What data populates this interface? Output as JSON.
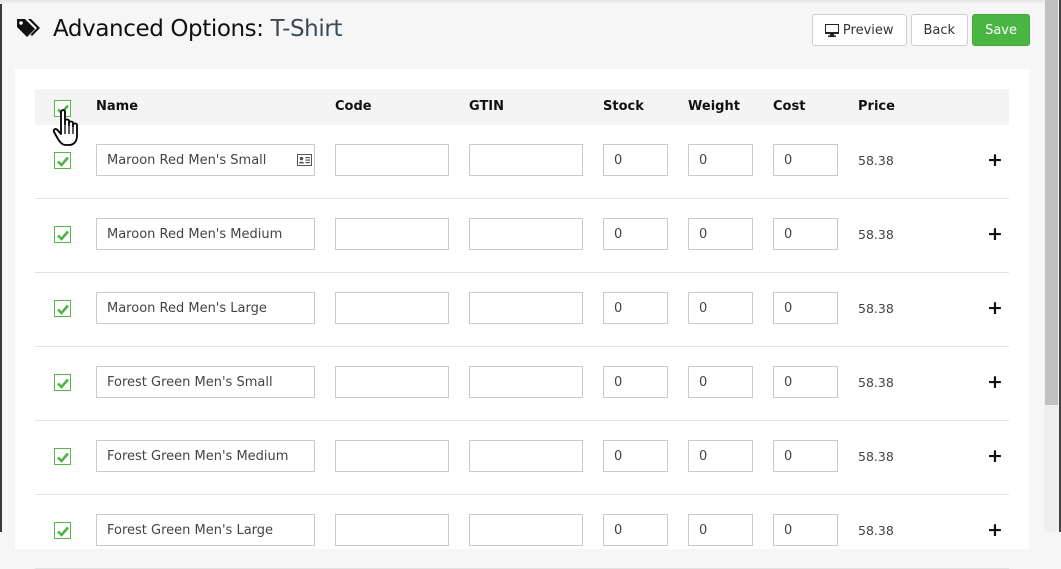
{
  "header": {
    "title": "Advanced Options:",
    "subtitle": "T-Shirt",
    "preview_label": "Preview",
    "back_label": "Back",
    "save_label": "Save"
  },
  "colors": {
    "accent": "#4bb543",
    "checkbox": "#55b84b"
  },
  "table": {
    "columns": [
      "Name",
      "Code",
      "GTIN",
      "Stock",
      "Weight",
      "Cost",
      "Price"
    ],
    "select_all_checked": true,
    "rows": [
      {
        "checked": true,
        "name": "Maroon Red Men's Small",
        "code": "",
        "gtin": "",
        "stock": "0",
        "weight": "0",
        "cost": "0",
        "price": "58.38"
      },
      {
        "checked": true,
        "name": "Maroon Red Men's Medium",
        "code": "",
        "gtin": "",
        "stock": "0",
        "weight": "0",
        "cost": "0",
        "price": "58.38"
      },
      {
        "checked": true,
        "name": "Maroon Red Men's Large",
        "code": "",
        "gtin": "",
        "stock": "0",
        "weight": "0",
        "cost": "0",
        "price": "58.38"
      },
      {
        "checked": true,
        "name": "Forest Green Men's Small",
        "code": "",
        "gtin": "",
        "stock": "0",
        "weight": "0",
        "cost": "0",
        "price": "58.38"
      },
      {
        "checked": true,
        "name": "Forest Green Men's Medium",
        "code": "",
        "gtin": "",
        "stock": "0",
        "weight": "0",
        "cost": "0",
        "price": "58.38"
      },
      {
        "checked": true,
        "name": "Forest Green Men's Large",
        "code": "",
        "gtin": "",
        "stock": "0",
        "weight": "0",
        "cost": "0",
        "price": "58.38"
      }
    ],
    "add_icon": "plus-icon"
  }
}
